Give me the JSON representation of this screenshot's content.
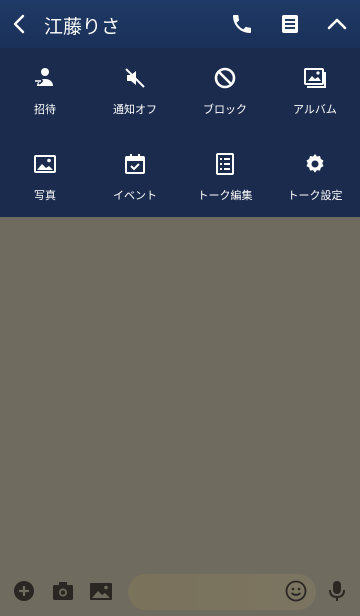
{
  "header": {
    "title": "江藤りさ",
    "icons": [
      "chevron-left-icon",
      "phone-icon",
      "note-icon",
      "chevron-up-icon"
    ]
  },
  "menu": {
    "items": [
      {
        "label": "招待",
        "icon": "invite-icon"
      },
      {
        "label": "通知オフ",
        "icon": "mute-icon"
      },
      {
        "label": "ブロック",
        "icon": "block-icon"
      },
      {
        "label": "アルバム",
        "icon": "album-icon"
      },
      {
        "label": "写真",
        "icon": "photo-icon"
      },
      {
        "label": "イベント",
        "icon": "event-icon"
      },
      {
        "label": "トーク編集",
        "icon": "edit-list-icon"
      },
      {
        "label": "トーク設定",
        "icon": "settings-icon"
      }
    ]
  },
  "bottom": {
    "icons": [
      "add-icon",
      "camera-icon",
      "image-icon",
      "emoji-icon",
      "mic-icon"
    ],
    "input_placeholder": ""
  },
  "colors": {
    "header_bg": "#1f3a66",
    "menu_bg": "#1a2b4d",
    "chat_bg": "#6f6b5f"
  }
}
